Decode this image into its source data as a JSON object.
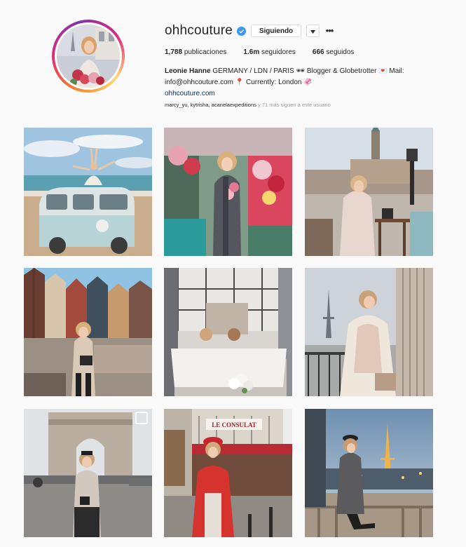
{
  "profile": {
    "username": "ohhcouture",
    "follow_label": "Siguiendo",
    "posts": "1,788",
    "posts_label": "publicaciones",
    "followers": "1.6m",
    "followers_label": "seguidores",
    "following": "666",
    "following_label": "seguidos",
    "bio_name": "Leonie Hanne",
    "bio_line1": " GERMANY / LDN / PARIS 🕶 Blogger & Globetrotter 💌 Mail:",
    "bio_line2": "info@ohhcouture.com 📍 Currently: London 🦑",
    "website": "ohhcouture.com",
    "followed_by_names": "marcy_yu, kytrisha, acanelaexpeditions",
    "followed_by_rest": " y 71 más siguen a este usuario"
  },
  "posts_grid": [
    {
      "subject": "beach-vw-van"
    },
    {
      "subject": "flower-shop"
    },
    {
      "subject": "hamburg-cafe"
    },
    {
      "subject": "canal-houses"
    },
    {
      "subject": "bathtub-loft"
    },
    {
      "subject": "eiffel-balcony"
    },
    {
      "subject": "arc-de-triomphe"
    },
    {
      "subject": "le-consulat"
    },
    {
      "subject": "eiffel-night"
    }
  ],
  "signboard": "LE CONSULAT",
  "colors": {
    "verified": "#3897f0",
    "link": "#003569",
    "muted": "#999999"
  },
  "icons": [
    "verified-badge-icon",
    "dropdown-arrow-icon",
    "more-options-icon"
  ]
}
